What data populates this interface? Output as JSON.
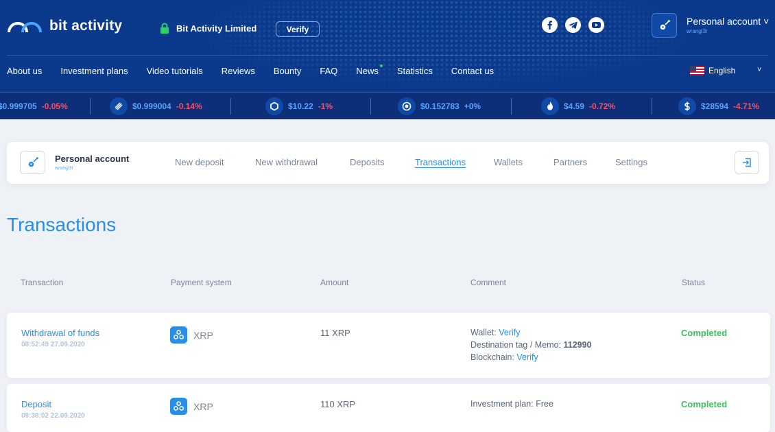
{
  "header": {
    "logo_text": "bit activity",
    "company_name": "Bit Activity Limited",
    "verify_label": "Verify",
    "social": [
      "facebook-icon",
      "telegram-icon",
      "youtube-icon"
    ],
    "account": {
      "title": "Personal account",
      "chevron": "˅",
      "username": "wrangl3r"
    },
    "nav": [
      "About us",
      "Investment plans",
      "Video tutorials",
      "Reviews",
      "Bounty",
      "FAQ",
      "News",
      "Statistics",
      "Contact us"
    ],
    "language": "English",
    "language_chevron": "˅"
  },
  "ticker": [
    {
      "price": "$0.999705",
      "change": "-0.05%",
      "direction": "down"
    },
    {
      "price": "$0.999004",
      "change": "-0.14%",
      "direction": "down",
      "icon": "coin-stripes-icon"
    },
    {
      "price": "$10.22",
      "change": "-1%",
      "direction": "down",
      "icon": "coin-hexagon-icon"
    },
    {
      "price": "$0.152783",
      "change": "+0%",
      "direction": "up",
      "icon": "coin-ring-icon"
    },
    {
      "price": "$4.59",
      "change": "-0.72%",
      "direction": "down",
      "icon": "coin-flame-icon"
    },
    {
      "price": "$28594",
      "change": "-4.71%",
      "direction": "down",
      "icon": "coin-dollar-icon"
    }
  ],
  "account_card": {
    "title": "Personal account",
    "username": "wrangl3r",
    "tabs": [
      "New deposit",
      "New withdrawal",
      "Deposits",
      "Transactions",
      "Wallets",
      "Partners",
      "Settings"
    ],
    "active_tab": "Transactions"
  },
  "page": {
    "title": "Transactions"
  },
  "table": {
    "headers": [
      "Transaction",
      "Payment system",
      "Amount",
      "Comment",
      "Status"
    ],
    "rows": [
      {
        "type": "Withdrawal of funds",
        "datetime": "08:52:49 27.09.2020",
        "payment_system": "XRP",
        "amount": "11 XRP",
        "comment": {
          "wallet_label": "Wallet: ",
          "wallet_value": "Verify",
          "tag_label": "Destination tag / Memo: ",
          "tag_value": "112990",
          "chain_label": "Blockchain: ",
          "chain_value": "Verify"
        },
        "status": "Completed"
      },
      {
        "type": "Deposit",
        "datetime": "09:38:02 22.09.2020",
        "payment_system": "XRP",
        "amount": "110 XRP",
        "comment": {
          "plan_label": "Investment plan: ",
          "plan_value": "Free"
        },
        "status": "Completed"
      }
    ]
  },
  "colors": {
    "header_bg": "#0b3a8c",
    "accent": "#2a8ee6",
    "negative": "#ff4d5e",
    "success": "#3bc15f"
  }
}
